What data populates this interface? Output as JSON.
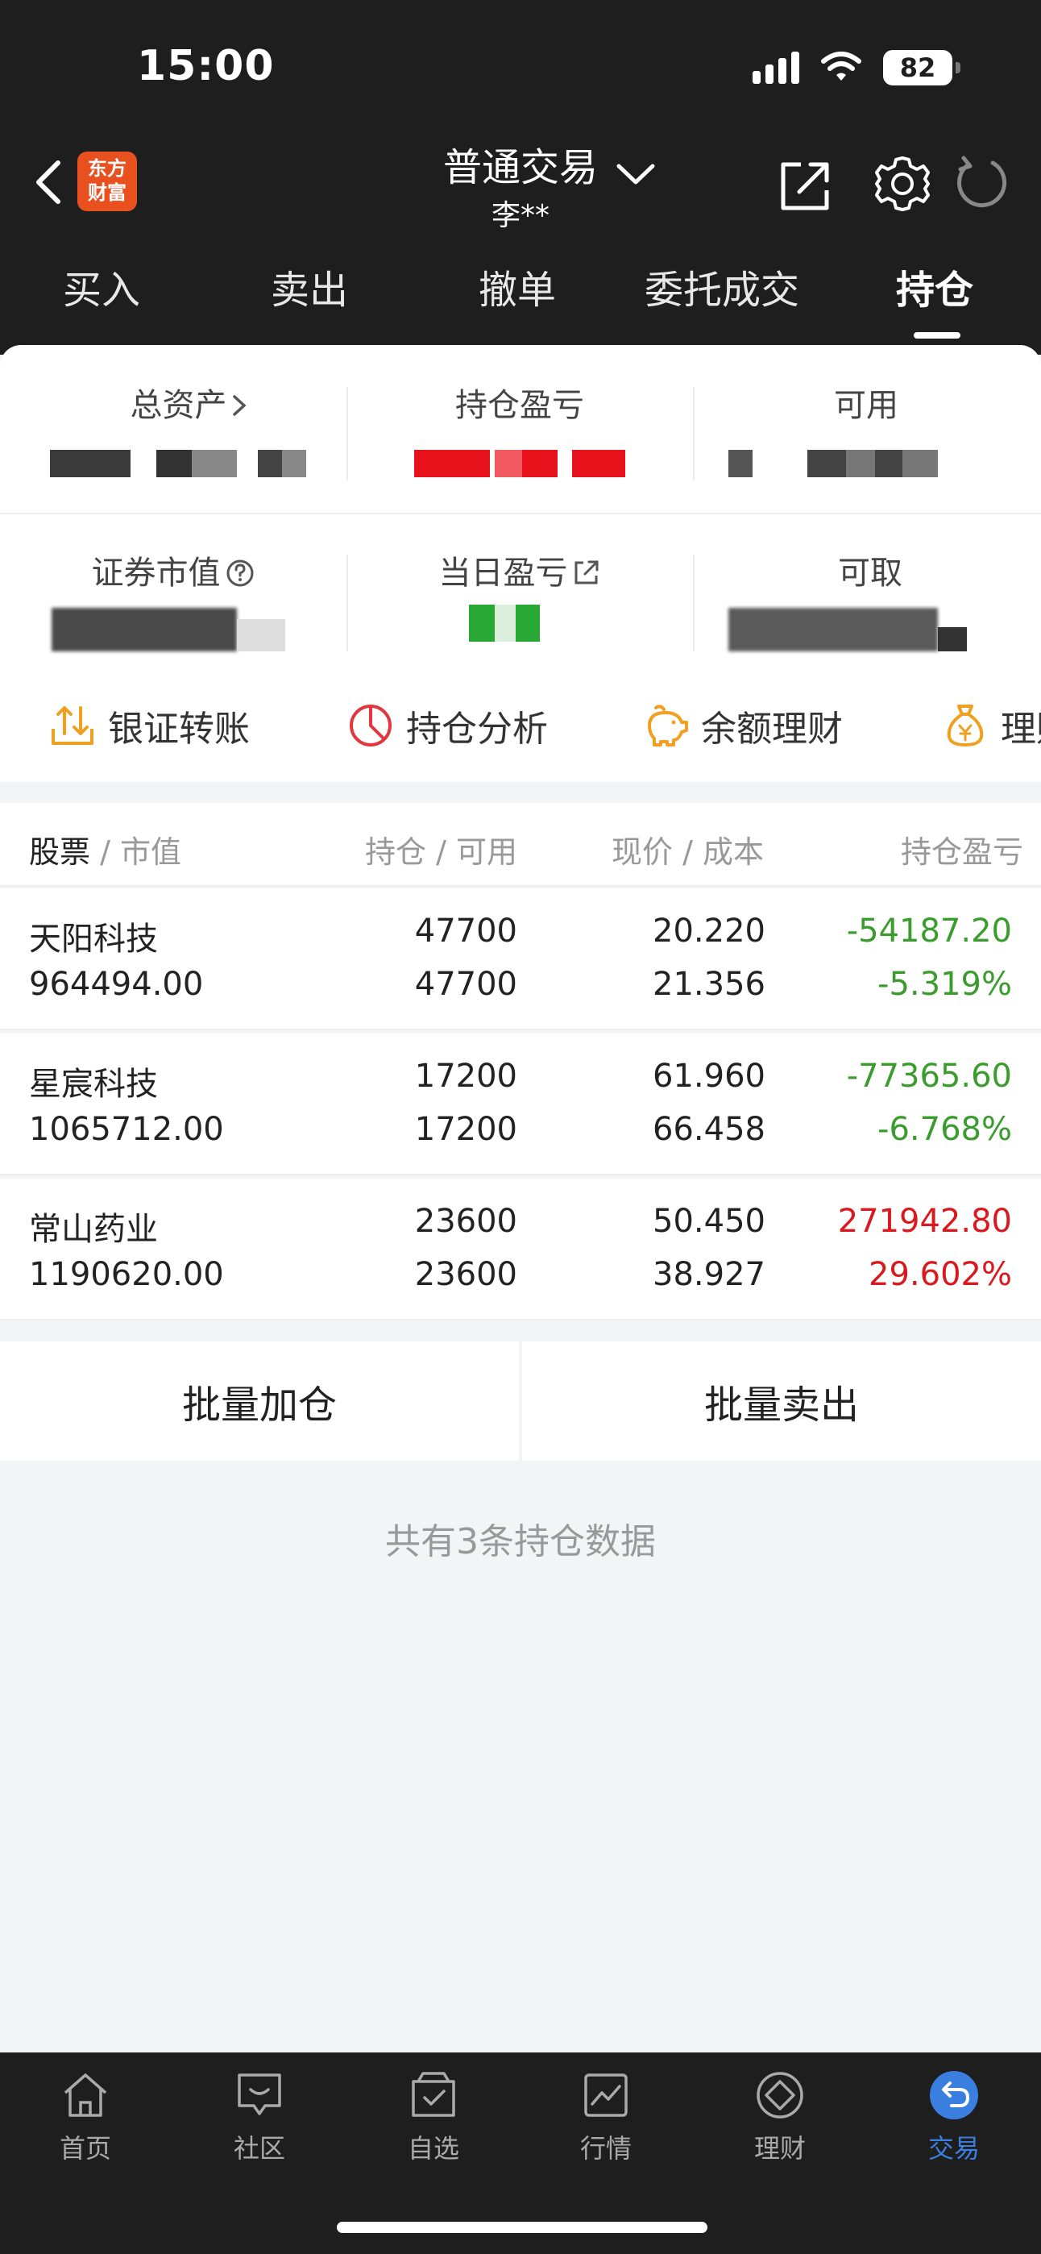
{
  "status_bar": {
    "time": "15:00",
    "battery": "82"
  },
  "header": {
    "logo_line1": "东方",
    "logo_line2": "财富",
    "title": "普通交易",
    "account": "李**"
  },
  "tabs": [
    {
      "label": "买入"
    },
    {
      "label": "卖出"
    },
    {
      "label": "撤单"
    },
    {
      "label": "委托成交"
    },
    {
      "label": "持仓",
      "active": true
    }
  ],
  "assets": {
    "total_assets": "总资产",
    "position_pnl": "持仓盈亏",
    "available": "可用",
    "market_value": "证券市值",
    "daily_pnl": "当日盈亏",
    "withdrawable": "可取"
  },
  "quick_actions": [
    {
      "label": "银证转账",
      "icon": "transfer-icon"
    },
    {
      "label": "持仓分析",
      "icon": "pie-chart-icon"
    },
    {
      "label": "余额理财",
      "icon": "piggy-bank-icon"
    },
    {
      "label": "理财",
      "icon": "money-bag-icon"
    }
  ],
  "table": {
    "headers": {
      "stock": "股票",
      "market_value": "市值",
      "position": "持仓",
      "available": "可用",
      "price": "现价",
      "cost": "成本",
      "pnl": "持仓盈亏"
    },
    "rows": [
      {
        "name": "天阳科技",
        "market_value": "964494.00",
        "position": "47700",
        "available": "47700",
        "price": "20.220",
        "cost": "21.356",
        "pnl": "-54187.20",
        "pnl_pct": "-5.319%",
        "trend": "down"
      },
      {
        "name": "星宸科技",
        "market_value": "1065712.00",
        "position": "17200",
        "available": "17200",
        "price": "61.960",
        "cost": "66.458",
        "pnl": "-77365.60",
        "pnl_pct": "-6.768%",
        "trend": "down"
      },
      {
        "name": "常山药业",
        "market_value": "1190620.00",
        "position": "23600",
        "available": "23600",
        "price": "50.450",
        "cost": "38.927",
        "pnl": "271942.80",
        "pnl_pct": "29.602%",
        "trend": "up"
      }
    ]
  },
  "batch": {
    "add": "批量加仓",
    "sell": "批量卖出"
  },
  "summary": "共有3条持仓数据",
  "bottom_nav": [
    {
      "label": "首页",
      "icon": "home-icon"
    },
    {
      "label": "社区",
      "icon": "community-icon"
    },
    {
      "label": "自选",
      "icon": "watchlist-icon"
    },
    {
      "label": "行情",
      "icon": "market-icon"
    },
    {
      "label": "理财",
      "icon": "wealth-icon"
    },
    {
      "label": "交易",
      "icon": "trade-icon",
      "active": true
    }
  ],
  "colors": {
    "up": "#d9191e",
    "down": "#3b9c2e",
    "accent": "#3a7fe0",
    "brand": "#e8511f"
  }
}
